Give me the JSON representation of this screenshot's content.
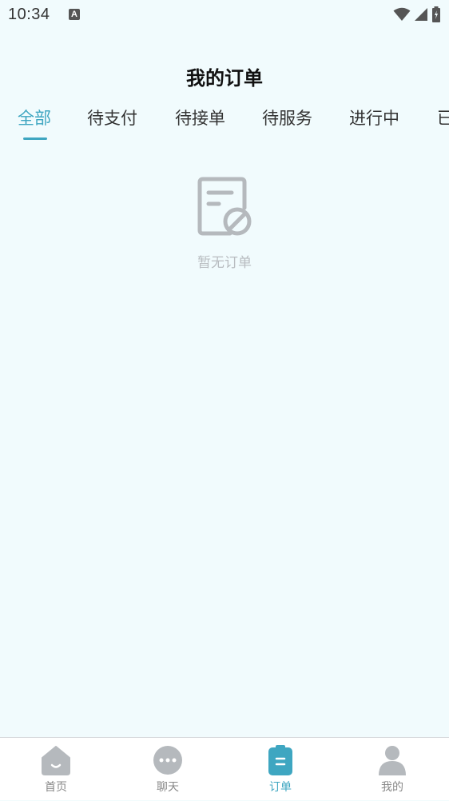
{
  "status_bar": {
    "time": "10:34",
    "notification_icon": "A"
  },
  "header": {
    "title": "我的订单"
  },
  "tabs": [
    {
      "label": "全部",
      "active": true
    },
    {
      "label": "待支付",
      "active": false
    },
    {
      "label": "待接单",
      "active": false
    },
    {
      "label": "待服务",
      "active": false
    },
    {
      "label": "进行中",
      "active": false
    },
    {
      "label": "已",
      "active": false
    }
  ],
  "empty_state": {
    "icon": "no-orders-icon",
    "text": "暂无订单"
  },
  "bottom_nav": [
    {
      "label": "首页",
      "icon": "home-icon",
      "active": false
    },
    {
      "label": "聊天",
      "icon": "chat-icon",
      "active": false
    },
    {
      "label": "订单",
      "icon": "orders-icon",
      "active": true
    },
    {
      "label": "我的",
      "icon": "profile-icon",
      "active": false
    }
  ],
  "colors": {
    "accent": "#3ea6c1",
    "background": "#f1fbfd",
    "inactive_icon": "#b5b9bd"
  }
}
